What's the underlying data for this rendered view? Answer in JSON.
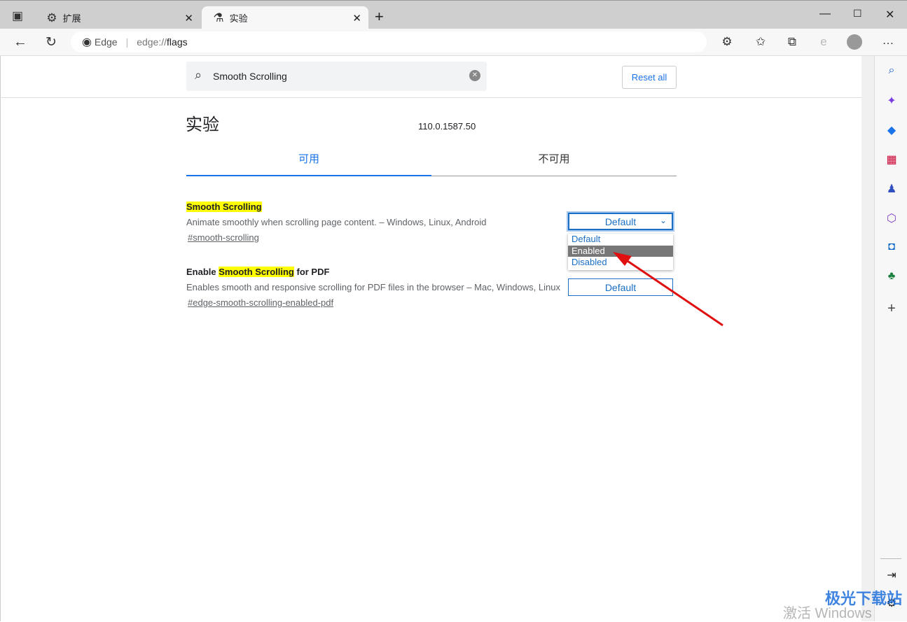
{
  "tabs": [
    {
      "label": "扩展",
      "icon": "puzzle-icon"
    },
    {
      "label": "实验",
      "icon": "flask-icon"
    }
  ],
  "address": {
    "site": "Edge",
    "url_prefix": "edge://",
    "url_main": "flags"
  },
  "search": {
    "value": "Smooth Scrolling"
  },
  "reset_label": "Reset all",
  "page_title": "实验",
  "version": "110.0.1587.50",
  "content_tabs": [
    {
      "label": "可用",
      "active": true
    },
    {
      "label": "不可用",
      "active": false
    }
  ],
  "flags": [
    {
      "title_pre": "",
      "title_hl": "Smooth Scrolling",
      "title_post": "",
      "desc": "Animate smoothly when scrolling page content. – Windows, Linux, Android",
      "link": "#smooth-scrolling",
      "value": "Default"
    },
    {
      "title_pre": "Enable ",
      "title_hl": "Smooth Scrolling",
      "title_post": " for PDF",
      "desc": "Enables smooth and responsive scrolling for PDF files in the browser – Mac, Windows, Linux",
      "link": "#edge-smooth-scrolling-enabled-pdf",
      "value": "Default"
    }
  ],
  "dropdown_options": [
    "Default",
    "Enabled",
    "Disabled"
  ],
  "dropdown_highlighted": "Enabled",
  "colors": {
    "accent": "#1a73e8",
    "select": "#1a6fc5",
    "highlight": "#ffff00",
    "arrow": "#e01010"
  },
  "watermark": {
    "brand": "极光下载站",
    "activation": "激活 Windows"
  }
}
